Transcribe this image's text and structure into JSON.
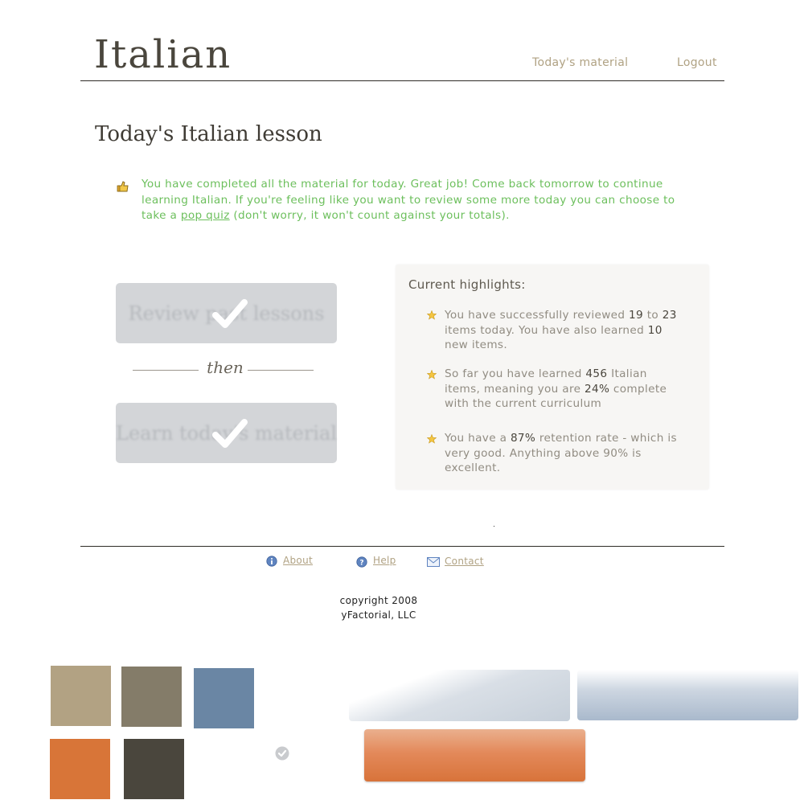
{
  "header": {
    "logo": "Italian",
    "nav": [
      {
        "label": "Today's material"
      },
      {
        "label": "Logout"
      }
    ]
  },
  "main": {
    "title": "Today's Italian lesson",
    "notice": {
      "icon": "thumbs-up-icon",
      "text_before": "You have completed all the material for today.  Great job!  Come back tomorrow to continue learning Italian.  If you're feeling like you want to review some more today you can choose to take a ",
      "link": "pop quiz",
      "text_after": " (don't worry, it won't count against your totals)."
    },
    "steps": {
      "review_label": "Review past lessons",
      "then_label": "then",
      "learn_label": "Learn today's material",
      "done_icon": "check-icon"
    },
    "highlights": {
      "title": "Current highlights:",
      "items": [
        {
          "icon": "star-icon",
          "parts": [
            "You have successfully reviewed ",
            "19",
            "  to ",
            "23",
            " items today.  You have also learned ",
            "10",
            " new items."
          ]
        },
        {
          "icon": "star-icon",
          "parts": [
            "So far you have learned ",
            "456",
            " Italian items, meaning you are ",
            "24%",
            " complete with the current curriculum"
          ]
        },
        {
          "icon": "star-icon",
          "parts": [
            "You have a ",
            "87%",
            " retention rate - which is very good.  Anything above 90% is excellent."
          ]
        }
      ]
    }
  },
  "footer": {
    "links": [
      {
        "label": "About",
        "icon": "info-icon"
      },
      {
        "label": "Help",
        "icon": "help-icon"
      },
      {
        "label": "Contact",
        "icon": "envelope-icon"
      }
    ],
    "copyright_line1": "copyright 2008",
    "copyright_line2": "yFactorial, LLC"
  },
  "colors": {
    "tan": "#b2a283",
    "taupe": "#847c69",
    "blue": "#6a86a4",
    "orange": "#d87538",
    "charcoal": "#4a463d",
    "note_green": "#6cbf5c",
    "link_tan": "#b0a283"
  }
}
